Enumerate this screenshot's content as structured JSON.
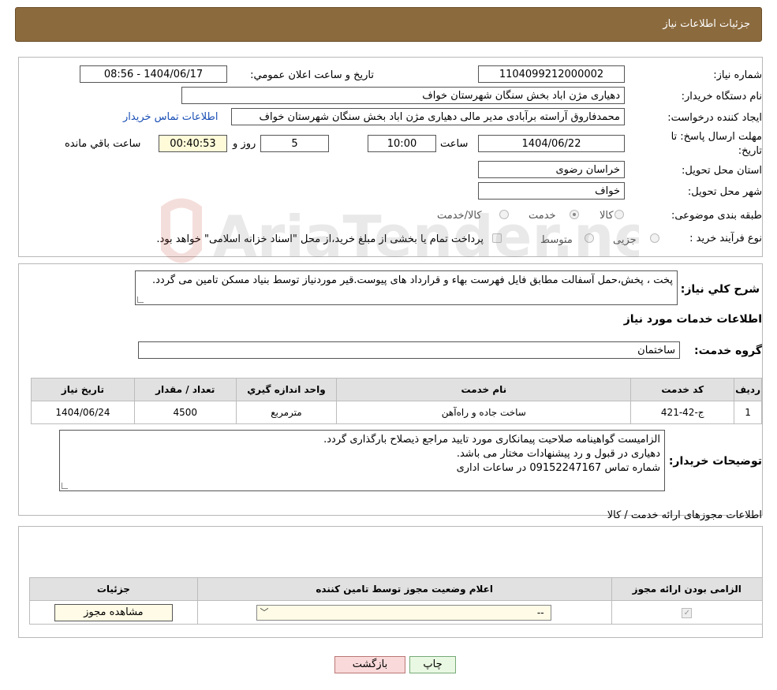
{
  "header": {
    "title": "جزئیات اطلاعات نیاز"
  },
  "form": {
    "need_number_label": "شماره نیاز:",
    "need_number": "1104099212000002",
    "announce_label": "تاریخ و ساعت اعلان عمومي:",
    "announce_value": "1404/06/17 - 08:56",
    "buyer_label": "نام دستگاه خريدار:",
    "buyer_value": "دهیاری مژن اباد بخش سنگان شهرستان خواف",
    "creator_label": "ايجاد کننده درخواست:",
    "creator_value": "محمدفاروق آراسته برآبادی مدیر مالی دهیاری مژن اباد بخش سنگان شهرستان خواف",
    "contact_link": "اطلاعات تماس خريدار",
    "deadline_label": "مهلت ارسال پاسخ: تا تاريخ:",
    "deadline_date": "1404/06/22",
    "time_label": "ساعت",
    "deadline_time": "10:00",
    "days_value": "5",
    "days_label": "روز و",
    "remaining_value": "00:40:53",
    "remaining_label": "ساعت باقي مانده",
    "province_label": "استان محل تحويل:",
    "province_value": "خراسان رضوی",
    "city_label": "شهر محل تحويل:",
    "city_value": "خواف",
    "category_label": "طبقه بندی موضوعی:",
    "category_options": [
      "کالا",
      "خدمت",
      "کالا/خدمت"
    ],
    "category_selected": "خدمت",
    "process_label": "نوع فرآيند خريد :",
    "process_options": [
      "جزیی",
      "متوسط"
    ],
    "process_note": "پرداخت تمام یا بخشی از مبلغ خرید،از محل \"اسناد خزانه اسلامی\" خواهد بود."
  },
  "description": {
    "label": "شرح کلي نياز:",
    "text": "پخت ، پخش،حمل  آسفالت مطابق فایل فهرست بهاء و قرارداد های پیوست.قیر موردنیاز توسط بنیاد مسکن تامین می گردد."
  },
  "services": {
    "section_title": "اطلاعات خدمات مورد نياز",
    "group_label": "گروه خدمت:",
    "group_value": "ساختمان",
    "columns": [
      "رديف",
      "کد خدمت",
      "نام خدمت",
      "واحد اندازه گيري",
      "تعداد / مقدار",
      "تاريخ نياز"
    ],
    "rows": [
      [
        "1",
        "ج-42-421",
        "ساخت جاده و راه‌آهن",
        "مترمربع",
        "4500",
        "1404/06/24"
      ]
    ]
  },
  "buyer_notes": {
    "label": "توضيحات خريدار:",
    "lines": [
      "الزامیست گواهینامه صلاحیت پیمانکاری مورد تایید مراجع ذیصلاح بارگذاری گردد.",
      "دهیاری در قبول و رد پیشنهادات مختار می باشد.",
      "شماره تماس 09152247167 در ساعات اداری"
    ]
  },
  "permits": {
    "section_title": "اطلاعات مجوزهای ارائه خدمت / کالا",
    "columns": [
      "الزامی بودن ارائه مجوز",
      "اعلام وضعیت مجوز توسط تامین کننده",
      "جزئیات"
    ],
    "select_value": "--",
    "view_button": "مشاهده مجوز"
  },
  "buttons": {
    "print": "چاپ",
    "back": "بازگشت"
  },
  "watermark": "AriaTender.neT",
  "colors": {
    "header_bg": "#8b6a3e",
    "link": "#1a4fb5",
    "back_btn": "#f9d9d9",
    "print_btn": "#e9f8e2"
  }
}
